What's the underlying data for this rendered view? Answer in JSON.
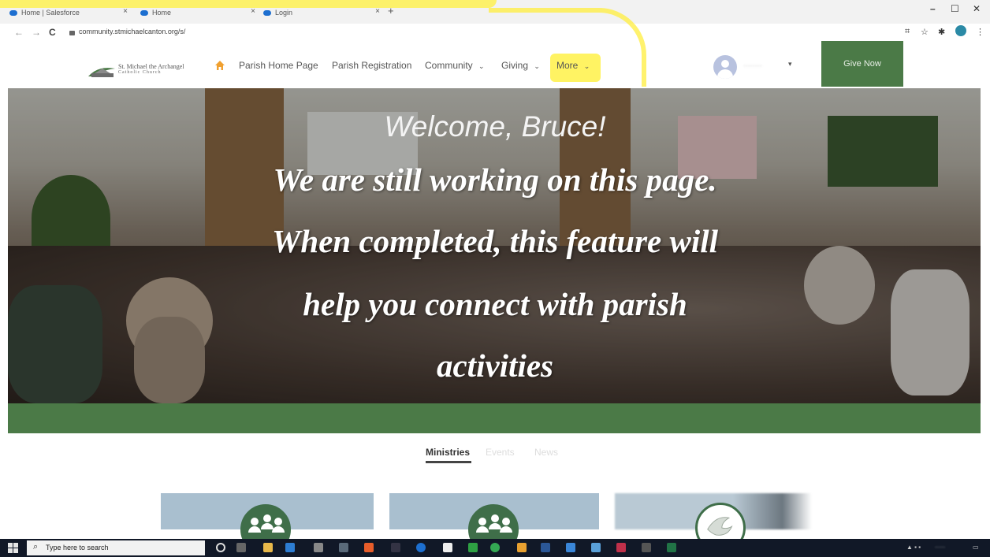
{
  "browser": {
    "tabs": [
      {
        "title": "Home | Salesforce",
        "close": "×"
      },
      {
        "title": "Home",
        "close": "×"
      },
      {
        "title": "Login",
        "close": "×"
      }
    ],
    "new_tab": "+",
    "window_controls": {
      "minimize": "–",
      "maximize": "☐",
      "close": "✕"
    },
    "url": "community.stmichaelcanton.org/s/",
    "nav_back": "←",
    "nav_forward": "→",
    "nav_reload": "C"
  },
  "site": {
    "logo": {
      "name": "St. Michael the Archangel",
      "sub": "Catholic Church"
    },
    "nav": [
      {
        "label": "Parish Home Page"
      },
      {
        "label": "Parish Registration"
      },
      {
        "label": "Community"
      },
      {
        "label": "Giving"
      },
      {
        "label": "More"
      }
    ],
    "chevron": "⌄",
    "user_caret": "▾",
    "give_button": "Give Now"
  },
  "hero": {
    "welcome": "Welcome, Bruce!",
    "lines": [
      "We are still working on this page.",
      "When completed, this feature will",
      "help you connect with parish",
      "activities"
    ]
  },
  "content_tabs": [
    {
      "label": "Ministries"
    },
    {
      "label": "Events"
    },
    {
      "label": "News"
    }
  ],
  "taskbar": {
    "search_placeholder": "Type here to search",
    "search_glyph": "⌕"
  },
  "colors": {
    "brand_green": "#4b7a47",
    "highlight_yellow": "#fff03c",
    "taskbar": "#111827"
  }
}
